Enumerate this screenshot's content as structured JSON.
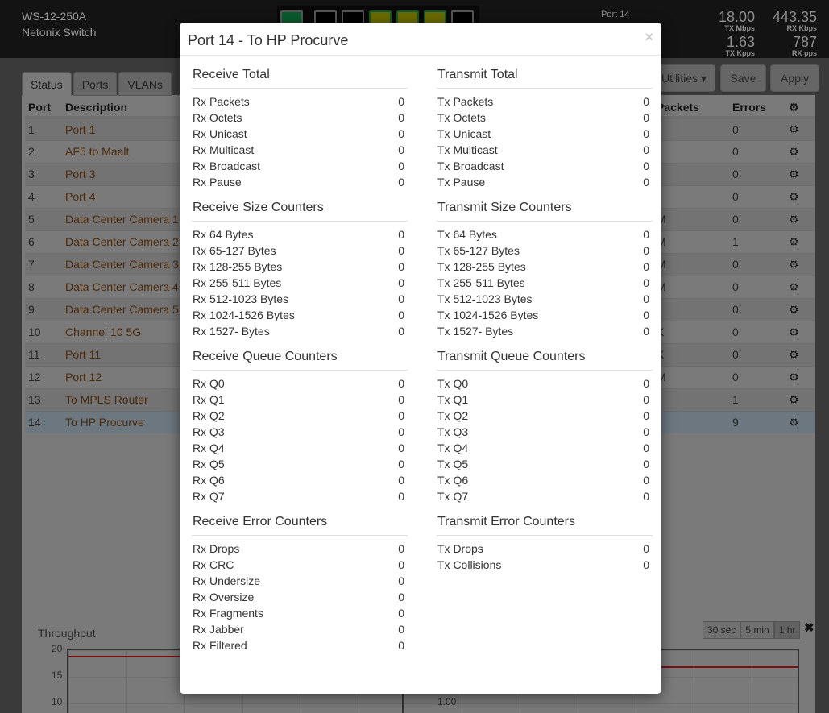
{
  "header": {
    "model": "WS-12-250A",
    "name": "Netonix Switch",
    "port_label": "Port 14",
    "stats": [
      {
        "value": "18.00",
        "unit": "TX Mbps"
      },
      {
        "value": "443.35",
        "unit": "RX Kbps"
      },
      {
        "value": "1.63",
        "unit": "TX Kpps"
      },
      {
        "value": "787",
        "unit": "RX pps"
      }
    ]
  },
  "tabs": [
    "Status",
    "Ports",
    "VLANs"
  ],
  "toolbar": {
    "utilities": "Utilities ▾",
    "save": "Save",
    "apply": "Apply"
  },
  "table": {
    "headers": {
      "port": "Port",
      "description": "Description",
      "packets": "Packets",
      "errors": "Errors"
    },
    "rows": [
      {
        "port": "1",
        "description": "Port 1",
        "packets": "",
        "errors": "0"
      },
      {
        "port": "2",
        "description": "AF5 to Maalt",
        "packets": "",
        "errors": "0"
      },
      {
        "port": "3",
        "description": "Port 3",
        "packets": "",
        "errors": "0"
      },
      {
        "port": "4",
        "description": "Port 4",
        "packets": "",
        "errors": "0"
      },
      {
        "port": "5",
        "description": "Data Center Camera 1",
        "packets": "M",
        "errors": "0"
      },
      {
        "port": "6",
        "description": "Data Center Camera 2",
        "packets": "M",
        "errors": "1"
      },
      {
        "port": "7",
        "description": "Data Center Camera 3",
        "packets": "M",
        "errors": "0"
      },
      {
        "port": "8",
        "description": "Data Center Camera 4",
        "packets": "M",
        "errors": "0"
      },
      {
        "port": "9",
        "description": "Data Center Camera 5",
        "packets": "l",
        "errors": "0"
      },
      {
        "port": "10",
        "description": "Channel 10 5G",
        "packets": "K",
        "errors": "0"
      },
      {
        "port": "11",
        "description": "Port 11",
        "packets": "K",
        "errors": "0"
      },
      {
        "port": "12",
        "description": "Port 12",
        "packets": "M",
        "errors": "0"
      },
      {
        "port": "13",
        "description": "To MPLS Router",
        "packets": "",
        "errors": "1"
      },
      {
        "port": "14",
        "description": "To HP Procurve",
        "packets": "l",
        "errors": "9"
      }
    ]
  },
  "throughput": {
    "title": "Throughput",
    "left_ticks": [
      "20",
      "15",
      "10"
    ],
    "right_ticks": [
      "1.00"
    ],
    "ranges": [
      "30 sec",
      "5 min",
      "1 hr"
    ],
    "active_range": "1 hr"
  },
  "modal": {
    "title": "Port 14 - To HP Procurve",
    "close": "×",
    "left": [
      {
        "title": "Receive Total",
        "rows": [
          [
            "Rx Packets",
            "0"
          ],
          [
            "Rx Octets",
            "0"
          ],
          [
            "Rx Unicast",
            "0"
          ],
          [
            "Rx Multicast",
            "0"
          ],
          [
            "Rx Broadcast",
            "0"
          ],
          [
            "Rx Pause",
            "0"
          ]
        ]
      },
      {
        "title": "Receive Size Counters",
        "rows": [
          [
            "Rx 64 Bytes",
            "0"
          ],
          [
            "Rx 65-127 Bytes",
            "0"
          ],
          [
            "Rx 128-255 Bytes",
            "0"
          ],
          [
            "Rx 255-511 Bytes",
            "0"
          ],
          [
            "Rx 512-1023 Bytes",
            "0"
          ],
          [
            "Rx 1024-1526 Bytes",
            "0"
          ],
          [
            "Rx 1527- Bytes",
            "0"
          ]
        ]
      },
      {
        "title": "Receive Queue Counters",
        "rows": [
          [
            "Rx Q0",
            "0"
          ],
          [
            "Rx Q1",
            "0"
          ],
          [
            "Rx Q2",
            "0"
          ],
          [
            "Rx Q3",
            "0"
          ],
          [
            "Rx Q4",
            "0"
          ],
          [
            "Rx Q5",
            "0"
          ],
          [
            "Rx Q6",
            "0"
          ],
          [
            "Rx Q7",
            "0"
          ]
        ]
      },
      {
        "title": "Receive Error Counters",
        "rows": [
          [
            "Rx Drops",
            "0"
          ],
          [
            "Rx CRC",
            "0"
          ],
          [
            "Rx Undersize",
            "0"
          ],
          [
            "Rx Oversize",
            "0"
          ],
          [
            "Rx Fragments",
            "0"
          ],
          [
            "Rx Jabber",
            "0"
          ],
          [
            "Rx Filtered",
            "0"
          ]
        ]
      }
    ],
    "right": [
      {
        "title": "Transmit Total",
        "rows": [
          [
            "Tx Packets",
            "0"
          ],
          [
            "Tx Octets",
            "0"
          ],
          [
            "Tx Unicast",
            "0"
          ],
          [
            "Tx Multicast",
            "0"
          ],
          [
            "Tx Broadcast",
            "0"
          ],
          [
            "Tx Pause",
            "0"
          ]
        ]
      },
      {
        "title": "Transmit Size Counters",
        "rows": [
          [
            "Tx 64 Bytes",
            "0"
          ],
          [
            "Tx 65-127 Bytes",
            "0"
          ],
          [
            "Tx 128-255 Bytes",
            "0"
          ],
          [
            "Tx 255-511 Bytes",
            "0"
          ],
          [
            "Tx 512-1023 Bytes",
            "0"
          ],
          [
            "Tx 1024-1526 Bytes",
            "0"
          ],
          [
            "Tx 1527- Bytes",
            "0"
          ]
        ]
      },
      {
        "title": "Transmit Queue Counters",
        "rows": [
          [
            "Tx Q0",
            "0"
          ],
          [
            "Tx Q1",
            "0"
          ],
          [
            "Tx Q2",
            "0"
          ],
          [
            "Tx Q3",
            "0"
          ],
          [
            "Tx Q4",
            "0"
          ],
          [
            "Tx Q5",
            "0"
          ],
          [
            "Tx Q6",
            "0"
          ],
          [
            "Tx Q7",
            "0"
          ]
        ]
      },
      {
        "title": "Transmit Error Counters",
        "rows": [
          [
            "Tx Drops",
            "0"
          ],
          [
            "Tx Collisions",
            "0"
          ]
        ]
      }
    ]
  }
}
